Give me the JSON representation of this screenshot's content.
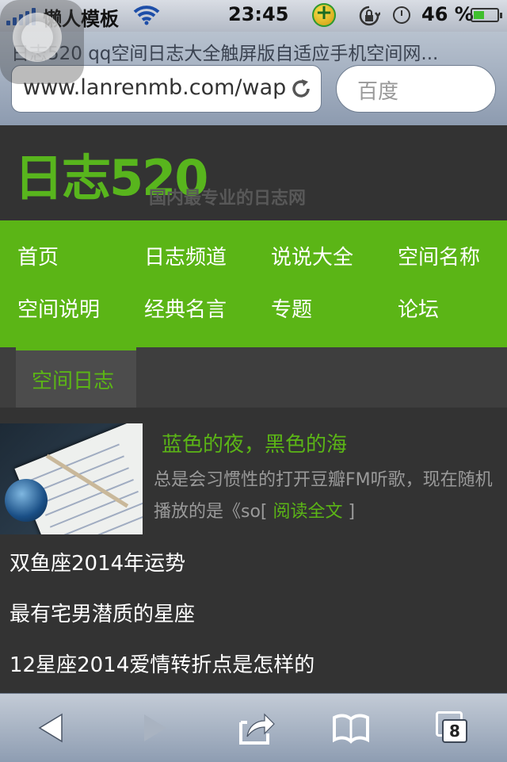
{
  "status_bar": {
    "carrier": "懒人模板",
    "time": "23:45",
    "battery_percent": "46 %",
    "battery_level": 0.46
  },
  "browser": {
    "page_title": "日志520 qq空间日志大全触屏版自适应手机空间网...",
    "url": "www.lanrenmb.com/wap",
    "search_placeholder": "百度",
    "tabs_count": "8"
  },
  "site": {
    "logo_text": "日志520",
    "tagline": "国内最专业的日志网"
  },
  "nav": {
    "items": [
      {
        "label": "首页"
      },
      {
        "label": "日志频道"
      },
      {
        "label": "说说大全"
      },
      {
        "label": "空间名称"
      },
      {
        "label": "空间说明"
      },
      {
        "label": "经典名言"
      },
      {
        "label": "专题"
      },
      {
        "label": "论坛"
      }
    ]
  },
  "tabs": {
    "active": "空间日志"
  },
  "featured_post": {
    "title": "蓝色的夜，黑色的海",
    "excerpt": "总是会习惯性的打开豆瓣FM听歌，现在随机播放的是《so[",
    "read_more": "阅读全文",
    "close_bracket": "]"
  },
  "article_list": [
    {
      "title": "双鱼座2014年运势"
    },
    {
      "title": "最有宅男潜质的星座"
    },
    {
      "title": "12星座2014爱情转折点是怎样的"
    }
  ],
  "colors": {
    "accent_green": "#5bb516",
    "background": "#333333"
  }
}
